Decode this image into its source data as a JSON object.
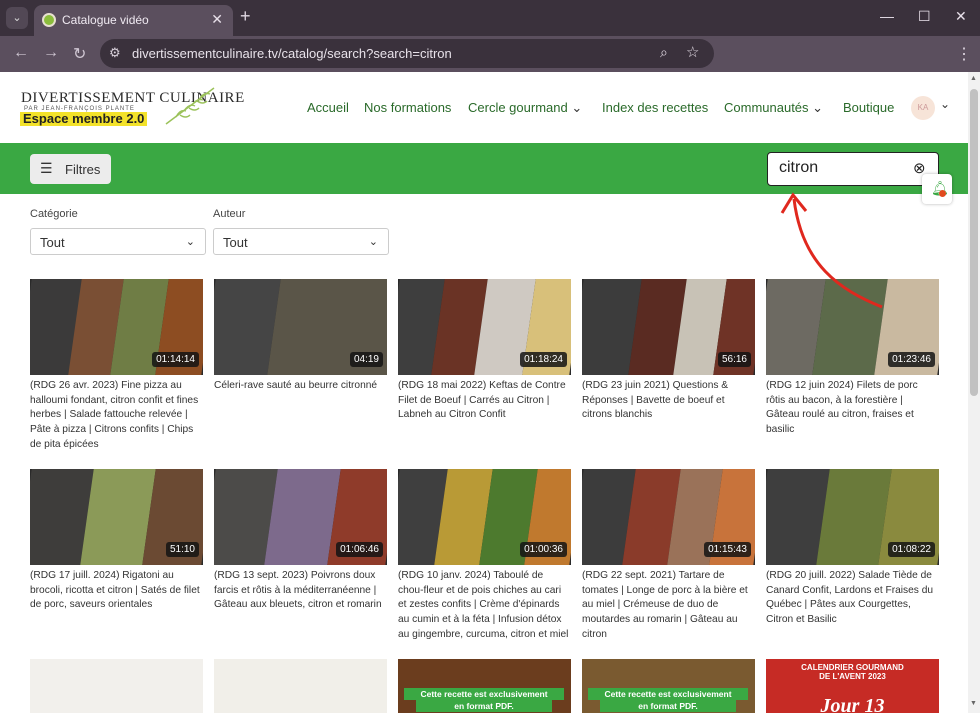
{
  "browser": {
    "tab_title": "Catalogue vidéo",
    "url": "divertissementculinaire.tv/catalog/search?search=citron"
  },
  "site": {
    "logo_line1": "DIVERTISSEMENT CULINAIRE",
    "logo_line2": "PAR JEAN-FRANÇOIS PLANTE",
    "logo_line3": "Espace membre 2.0",
    "nav": [
      "Accueil",
      "Nos formations",
      "Cercle gourmand",
      "Index des recettes",
      "Communautés",
      "Boutique"
    ],
    "avatar_initials": "KA"
  },
  "toolbar": {
    "filters_label": "Filtres",
    "search_value": "citron"
  },
  "filters": {
    "category_label": "Catégorie",
    "category_value": "Tout",
    "author_label": "Auteur",
    "author_value": "Tout"
  },
  "videos": [
    {
      "duration": "01:14:14",
      "title": "(RDG 26 avr. 2023) Fine pizza au halloumi fondant, citron confit et fines herbes | Salade fattouche relevée | Pâte à pizza | Citrons confits | Chips de pita épicées"
    },
    {
      "duration": "04:19",
      "title": "Céleri-rave sauté au beurre citronné"
    },
    {
      "duration": "01:18:24",
      "title": "(RDG 18 mai 2022) Keftas de Contre Filet de Boeuf | Carrés au Citron | Labneh au Citron Confit"
    },
    {
      "duration": "56:16",
      "title": "(RDG 23 juin 2021) Questions & Réponses | Bavette de boeuf et citrons blanchis"
    },
    {
      "duration": "01:23:46",
      "title": "(RDG 12 juin 2024) Filets de porc rôtis au bacon, à la forestière | Gâteau roulé au citron, fraises et basilic"
    },
    {
      "duration": "51:10",
      "title": "(RDG 17 juill. 2024) Rigatoni au brocoli, ricotta et citron | Satés de filet de porc, saveurs orientales"
    },
    {
      "duration": "01:06:46",
      "title": "(RDG 13 sept. 2023) Poivrons doux farcis et rôtis à la méditerranéenne | Gâteau aux bleuets, citron et romarin"
    },
    {
      "duration": "01:00:36",
      "title": "(RDG 10 janv. 2024) Taboulé de chou-fleur et de pois chiches au cari et zestes confits | Crème d'épinards au cumin et à la féta | Infusion détox au gingembre, curcuma, citron et miel"
    },
    {
      "duration": "01:15:43",
      "title": "(RDG 22 sept. 2021) Tartare de tomates | Longe de porc à la bière et au miel | Crémeuse de duo de moutardes au romarin | Gâteau au citron"
    },
    {
      "duration": "01:08:22",
      "title": "(RDG 20 juill. 2022) Salade Tiède de Canard Confit, Lardons et Fraises du Québec | Pâtes aux Courgettes, Citron et Basilic"
    }
  ],
  "row3": {
    "pdf_line1": "Cette recette est exclusivement",
    "pdf_line2": "en format PDF.",
    "calendar_line1": "CALENDRIER GOURMAND",
    "calendar_line2": "DE L'AVENT 2023",
    "calendar_day": "Jour 13"
  },
  "colors": {
    "accent_green": "#3aa843",
    "nav_green": "#2a6a2a",
    "arrow_red": "#e0281e"
  }
}
